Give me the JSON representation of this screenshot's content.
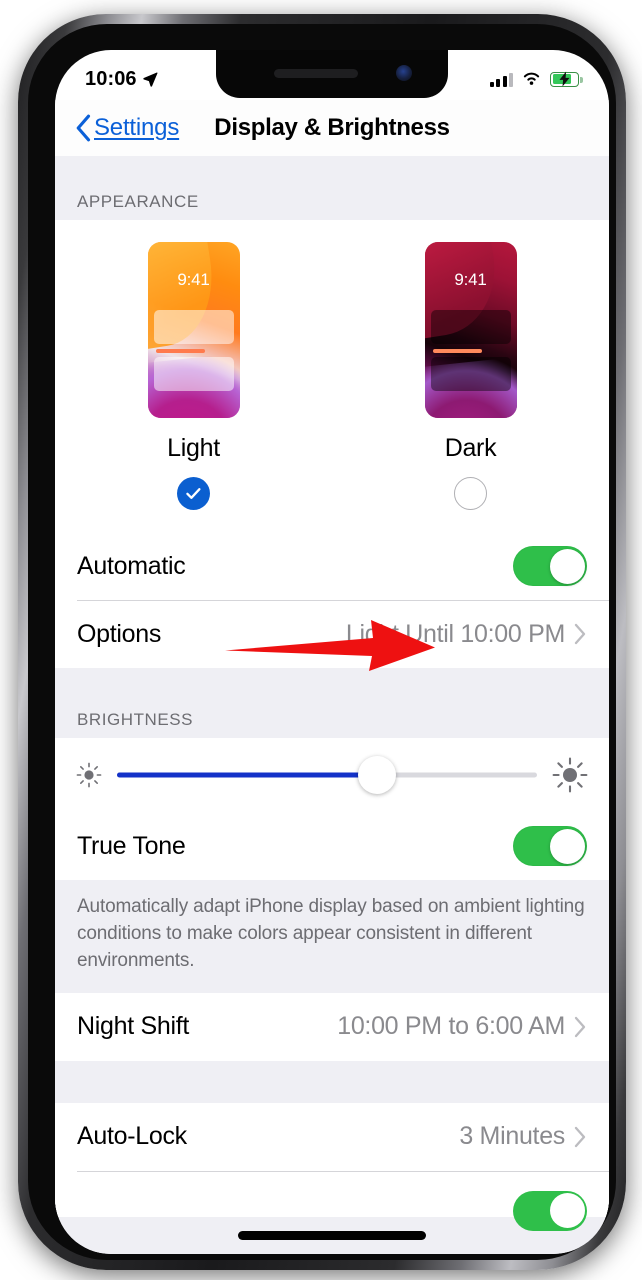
{
  "status_bar": {
    "time": "10:06",
    "location_icon": "location-arrow-icon",
    "cellular_icon": "cellular-signal-icon",
    "wifi_icon": "wifi-icon",
    "battery_icon": "battery-charging-icon"
  },
  "nav": {
    "back_label": "Settings",
    "back_icon": "chevron-left-icon",
    "title": "Display & Brightness"
  },
  "appearance": {
    "header": "APPEARANCE",
    "options": [
      {
        "name": "Light",
        "preview_time": "9:41",
        "selected": true
      },
      {
        "name": "Dark",
        "preview_time": "9:41",
        "selected": false
      }
    ],
    "automatic": {
      "label": "Automatic",
      "toggle_state": "on"
    },
    "options_row": {
      "label": "Options",
      "value": "Light Until 10:00 PM",
      "chevron_icon": "chevron-right-icon"
    }
  },
  "brightness": {
    "header": "BRIGHTNESS",
    "slider": {
      "min_icon": "sun-small-icon",
      "max_icon": "sun-large-icon",
      "value_percent": 62
    },
    "true_tone": {
      "label": "True Tone",
      "toggle_state": "on"
    },
    "footnote": "Automatically adapt iPhone display based on ambient lighting conditions to make colors appear consistent in different environments."
  },
  "night_shift": {
    "label": "Night Shift",
    "value": "10:00 PM to 6:00 AM",
    "chevron_icon": "chevron-right-icon"
  },
  "auto_lock": {
    "label": "Auto-Lock",
    "value": "3 Minutes",
    "chevron_icon": "chevron-right-icon"
  },
  "annotation": {
    "arrow_icon": "red-arrow-pointing-right",
    "color": "#ee1111",
    "points_at": "Automatic toggle"
  },
  "colors": {
    "accent_blue": "#0b60d8",
    "toggle_green": "#2fbf4a",
    "slider_blue": "#1432c8",
    "group_bg": "#ffffff",
    "page_bg": "#efeff4",
    "secondary_text": "#8a8a8e"
  }
}
